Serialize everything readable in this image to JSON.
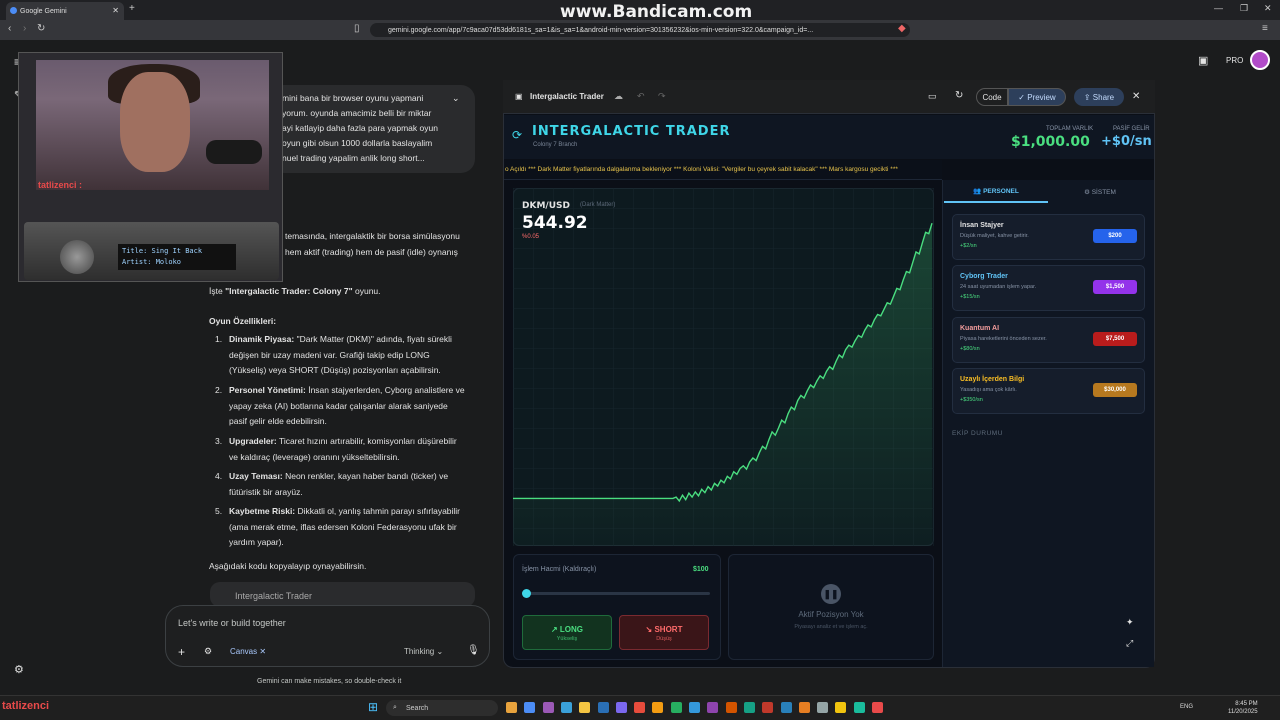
{
  "browser": {
    "tab_title": "Google Gemini",
    "url": "gemini.google.com/app/7c9aca07d53dd6181s_sa=1&is_sa=1&android-min-version=301356232&ios-min-version=322.0&campaign_id=...",
    "watermark": "www.Bandicam.com"
  },
  "gemini": {
    "badge": "PRO",
    "user_message": [
      "mini bana bir browser oyunu yapmani",
      "yorum. oyunda amacimiz belli bir miktar",
      "ayi katlayip daha fazla para yapmak oyun",
      "oyun gibi olsun 1000 dollarla baslayalim",
      "nuel trading yapalim anlik long short..."
    ],
    "resp_intro": [
      "temasında, intergalaktik bir borsa simülasyonu",
      "hem aktif (trading) hem de pasif (idle) oynanış"
    ],
    "resp_game_pre": "İşte ",
    "resp_game_name": "\"Intergalactic Trader: Colony 7\"",
    "resp_game_post": " oyunu.",
    "features_title": "Oyun Özellikleri:",
    "features": [
      {
        "num": "1.",
        "title": "Dinamik Piyasa:",
        "lines": [
          "\"Dark Matter (DKM)\" adında, fiyatı sürekli",
          "değişen bir uzay madeni var. Grafiği takip edip LONG",
          "(Yükseliş) veya SHORT (Düşüş) pozisyonları açabilirsin."
        ]
      },
      {
        "num": "2.",
        "title": "Personel Yönetimi:",
        "lines": [
          "İnsan stajyerlerden, Cyborg analistlere ve",
          "yapay zeka (AI) botlarına kadar çalışanlar alarak saniyede",
          "pasif gelir elde edebilirsin."
        ]
      },
      {
        "num": "3.",
        "title": "Upgradeler:",
        "lines": [
          "Ticaret hızını artırabilir, komisyonları düşürebilir",
          "ve kaldıraç (leverage) oranını yükseltebilirsin."
        ]
      },
      {
        "num": "4.",
        "title": "Uzay Teması:",
        "lines": [
          "Neon renkler, kayan haber bandı (ticker) ve",
          "fütüristik bir arayüz."
        ]
      },
      {
        "num": "5.",
        "title": "Kaybetme Riski:",
        "lines": [
          "Dikkatli ol, yanlış tahmin parayı sıfırlayabilir",
          "(ama merak etme, iflas edersen Koloni Federasyonu ufak bir",
          "yardım yapar)."
        ]
      }
    ],
    "copy_hint": "Aşağıdaki kodu kopyalayıp oynayabilirsin.",
    "code_card": "Intergalactic Trader",
    "input_placeholder": "Let's write or build together",
    "canvas_chip": "Canvas",
    "mode": "Thinking",
    "disclaimer": "Gemini can make mistakes, so double-check it"
  },
  "webcam": {
    "name": "tatlizenci :",
    "radio_title": "Title: Sing It Back",
    "radio_artist": "Artist: Moloko",
    "corner_name": "tatlizenci"
  },
  "canvas": {
    "title": "Intergalactic Trader",
    "code_label": "Code",
    "preview_label": "Preview",
    "share_label": "Share"
  },
  "game": {
    "title": "INTERGALACTIC TRADER",
    "colony": "Colony 7 Branch",
    "networth_label": "TOPLAM VARLIK",
    "networth": "$1,000.00",
    "passive_label": "PASİF GELİR",
    "passive": "+$0/sn",
    "ticker": "o Açıldı *** Dark Matter fiyatlarında dalgalanma bekleniyor *** Koloni Valisi: \"Vergiler bu çeyrek sabit kalacak\" *** Mars kargosu gecikti ***",
    "pair": "DKM/USD",
    "pair_sub": "(Dark Matter)",
    "price": "544.92",
    "pct": "%0.05",
    "volume_label": "İşlem Hacmi (Kaldıraçlı)",
    "volume": "$100",
    "long_label": "LONG",
    "long_sub": "Yükseliş",
    "short_label": "SHORT",
    "short_sub": "Düşüş",
    "position_title": "Aktif Pozisyon Yok",
    "position_sub": "Piyasayı analiz et ve işlem aç.",
    "tab_personel": "PERSONEL",
    "tab_sistem": "SİSTEM",
    "team_label": "EKİP DURUMU",
    "staff": [
      {
        "name": "İnsan Stajyer",
        "desc": "Düşük maliyet, kahve getirir.",
        "rate": "+$2/sn",
        "price": "$200",
        "color": "#2563eb",
        "name_color": "#e3e3e3"
      },
      {
        "name": "Cyborg Trader",
        "desc": "24 saat uyumadan işlem yapar.",
        "rate": "+$15/sn",
        "price": "$1,500",
        "color": "#9333ea",
        "name_color": "#60c3f5"
      },
      {
        "name": "Kuantum AI",
        "desc": "Piyasa hareketlerini önceden sezer.",
        "rate": "+$80/sn",
        "price": "$7,500",
        "color": "#b91c1c",
        "name_color": "#f59e9e"
      },
      {
        "name": "Uzaylı İçerden Bilgi",
        "desc": "Yasadışı ama çok kârlı.",
        "rate": "+$350/sn",
        "price": "$30,000",
        "color": "#b7791f",
        "name_color": "#fbbf24"
      }
    ],
    "price_series": [
      510,
      510,
      510,
      510,
      510,
      510,
      510,
      510,
      510,
      510,
      510,
      510,
      510,
      510,
      510,
      510,
      510,
      510,
      510,
      510,
      510,
      510,
      510,
      510,
      510,
      510,
      510,
      510,
      510,
      510,
      510,
      510,
      510,
      510,
      510,
      510,
      510,
      510,
      510,
      510,
      510,
      510,
      510,
      510,
      510,
      510,
      510,
      510,
      510,
      510,
      510,
      512,
      506,
      515,
      508,
      518,
      512,
      520,
      514,
      524,
      519,
      528,
      523,
      533,
      529,
      538,
      534,
      544,
      540,
      551,
      547,
      556,
      560,
      555,
      566,
      572,
      568,
      580,
      590,
      586,
      600,
      612,
      607,
      618,
      630,
      626,
      640,
      650,
      646,
      660,
      668,
      664,
      675,
      684,
      680,
      690,
      698,
      694,
      705,
      712,
      708,
      720,
      730,
      726,
      738,
      745,
      742,
      752,
      760,
      757,
      768,
      776,
      773,
      784,
      792,
      790,
      800,
      810,
      808,
      820,
      832,
      830,
      845,
      858,
      856,
      872,
      888,
      885,
      902,
      918,
      916,
      932
    ]
  },
  "taskbar": {
    "search": "Search",
    "time": "8:45 PM",
    "date": "11/20/2025",
    "lang": "ENG"
  }
}
